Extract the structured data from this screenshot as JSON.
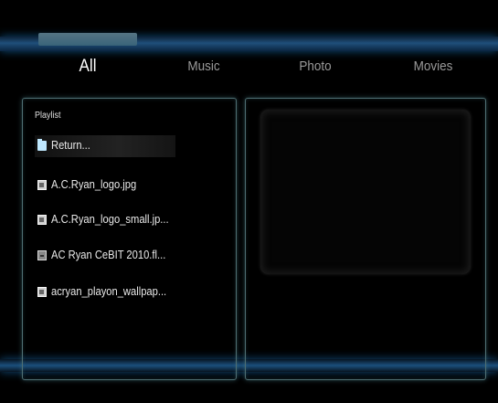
{
  "tabs": [
    {
      "label": "All",
      "active": true
    },
    {
      "label": "Music",
      "active": false
    },
    {
      "label": "Photo",
      "active": false
    },
    {
      "label": "Movies",
      "active": false
    }
  ],
  "playlist": {
    "title": "Playlist",
    "items": [
      {
        "label": "Return...",
        "icon": "folder-icon",
        "selected": true
      },
      {
        "label": "A.C.Ryan_logo.jpg",
        "icon": "image-file-icon"
      },
      {
        "label": "A.C.Ryan_logo_small.jp...",
        "icon": "image-file-icon"
      },
      {
        "label": "AC Ryan CeBIT 2010.fl...",
        "icon": "video-file-icon"
      },
      {
        "label": "acryan_playon_wallpap...",
        "icon": "image-file-icon"
      }
    ]
  },
  "colors": {
    "background": "#000000",
    "accent_blue": "#1f4f7a",
    "panel_border": "#4f6f73"
  }
}
